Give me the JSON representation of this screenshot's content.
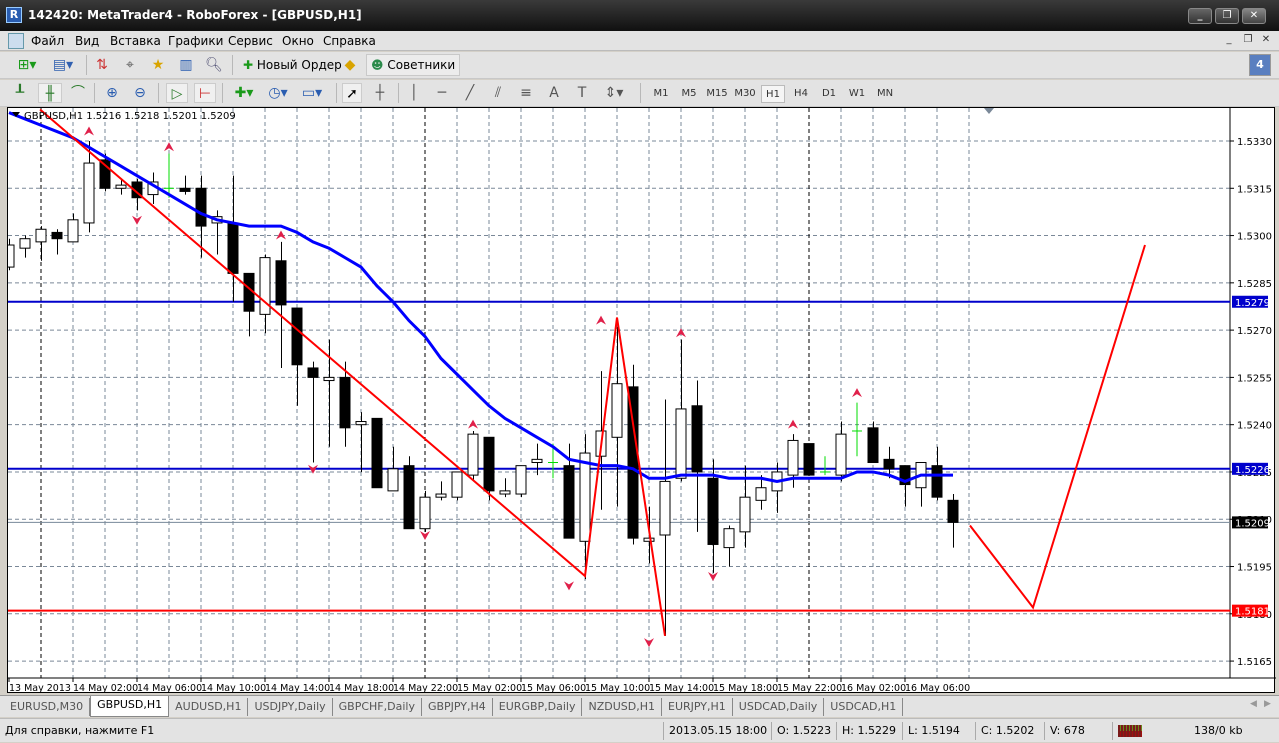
{
  "window": {
    "title": "142420: MetaTrader4 - RoboForex - [GBPUSD,H1]",
    "minimize": "_",
    "restore": "❐",
    "close": "✕"
  },
  "menu": [
    "Файл",
    "Вид",
    "Вставка",
    "Графики",
    "Сервис",
    "Окно",
    "Справка"
  ],
  "toolbar": {
    "new_order": "Новый Ордер",
    "experts": "Советники",
    "notifications_count": "4"
  },
  "timeframes": [
    "M1",
    "M5",
    "M15",
    "M30",
    "H1",
    "H4",
    "D1",
    "W1",
    "MN"
  ],
  "active_timeframe": "H1",
  "chart_header": "GBPUSD,H1  1.5216 1.5218 1.5201 1.5209",
  "tabs": [
    "EURUSD,M30",
    "GBPUSD,H1",
    "AUDUSD,H1",
    "USDJPY,Daily",
    "GBPCHF,Daily",
    "GBPJPY,H4",
    "EURGBP,Daily",
    "NZDUSD,H1",
    "EURJPY,H1",
    "USDCAD,Daily",
    "USDCAD,H1"
  ],
  "active_tab": "GBPUSD,H1",
  "status": {
    "help": "Для справки, нажмите F1",
    "datetime": "2013.05.15 18:00",
    "open": "O: 1.5223",
    "high": "H: 1.5229",
    "low": "L: 1.5194",
    "close": "C: 1.5202",
    "volume": "V: 678",
    "traffic": "138/0 kb"
  },
  "chart_data": {
    "type": "candlestick",
    "symbol": "GBPUSD",
    "timeframe": "H1",
    "ylim": [
      1.5158,
      1.5348
    ],
    "y_ticks": [
      "1.5330",
      "1.5315",
      "1.5300",
      "1.5285",
      "1.5270",
      "1.5255",
      "1.5240",
      "1.5225",
      "1.5210",
      "1.5195",
      "1.5180",
      "1.5165"
    ],
    "x_labels": [
      "13 May 2013",
      "14 May 02:00",
      "14 May 06:00",
      "14 May 10:00",
      "14 May 14:00",
      "14 May 18:00",
      "14 May 22:00",
      "15 May 02:00",
      "15 May 06:00",
      "15 May 10:00",
      "15 May 14:00",
      "15 May 18:00",
      "15 May 22:00",
      "16 May 02:00",
      "16 May 06:00"
    ],
    "day_separators": [
      2,
      26,
      50
    ],
    "ohlc": [
      [
        1.529,
        1.5299,
        1.5289,
        1.5297
      ],
      [
        1.5296,
        1.53,
        1.5293,
        1.5299
      ],
      [
        1.5298,
        1.5303,
        1.5292,
        1.5302
      ],
      [
        1.5301,
        1.5302,
        1.5294,
        1.5299
      ],
      [
        1.5298,
        1.5307,
        1.5298,
        1.5305
      ],
      [
        1.5304,
        1.533,
        1.5301,
        1.5323
      ],
      [
        1.5324,
        1.5326,
        1.5314,
        1.5315
      ],
      [
        1.5315,
        1.5318,
        1.5313,
        1.5316
      ],
      [
        1.5317,
        1.5318,
        1.5308,
        1.5312
      ],
      [
        1.5313,
        1.532,
        1.531,
        1.5317
      ],
      [
        1.5315,
        1.5326,
        1.5312,
        1.5315
      ],
      [
        1.5315,
        1.5319,
        1.5313,
        1.5314
      ],
      [
        1.5315,
        1.5319,
        1.5293,
        1.5303
      ],
      [
        1.5304,
        1.5308,
        1.5294,
        1.5306
      ],
      [
        1.5304,
        1.5319,
        1.5279,
        1.5288
      ],
      [
        1.5288,
        1.5288,
        1.5268,
        1.5276
      ],
      [
        1.5275,
        1.5294,
        1.5269,
        1.5293
      ],
      [
        1.5292,
        1.5298,
        1.5258,
        1.5278
      ],
      [
        1.5277,
        1.5277,
        1.5246,
        1.5259
      ],
      [
        1.5258,
        1.526,
        1.5228,
        1.5255
      ],
      [
        1.5254,
        1.5267,
        1.5233,
        1.5255
      ],
      [
        1.5255,
        1.526,
        1.5233,
        1.5239
      ],
      [
        1.524,
        1.5244,
        1.5225,
        1.5241
      ],
      [
        1.5242,
        1.5242,
        1.522,
        1.522
      ],
      [
        1.5219,
        1.5233,
        1.5219,
        1.5226
      ],
      [
        1.5227,
        1.523,
        1.5207,
        1.5207
      ],
      [
        1.5207,
        1.5219,
        1.5206,
        1.5217
      ],
      [
        1.5217,
        1.5222,
        1.5216,
        1.5218
      ],
      [
        1.5217,
        1.5225,
        1.5216,
        1.5225
      ],
      [
        1.5224,
        1.5238,
        1.5222,
        1.5237
      ],
      [
        1.5236,
        1.5236,
        1.5216,
        1.5219
      ],
      [
        1.5218,
        1.5223,
        1.5217,
        1.5219
      ],
      [
        1.5218,
        1.5227,
        1.5217,
        1.5227
      ],
      [
        1.5228,
        1.5234,
        1.5224,
        1.5229
      ],
      [
        1.5228,
        1.5234,
        1.5223,
        1.5228
      ],
      [
        1.5227,
        1.5234,
        1.5204,
        1.5204
      ],
      [
        1.5203,
        1.5237,
        1.5191,
        1.5231
      ],
      [
        1.523,
        1.5257,
        1.5213,
        1.5238
      ],
      [
        1.5236,
        1.5271,
        1.5214,
        1.5253
      ],
      [
        1.5252,
        1.5259,
        1.5202,
        1.5204
      ],
      [
        1.5203,
        1.5214,
        1.5196,
        1.5204
      ],
      [
        1.5205,
        1.5248,
        1.5173,
        1.5222
      ],
      [
        1.5223,
        1.5267,
        1.5222,
        1.5245
      ],
      [
        1.5246,
        1.5254,
        1.5206,
        1.5225
      ],
      [
        1.5223,
        1.5229,
        1.5193,
        1.5202
      ],
      [
        1.5201,
        1.5208,
        1.5195,
        1.5207
      ],
      [
        1.5206,
        1.5227,
        1.5201,
        1.5217
      ],
      [
        1.5216,
        1.5224,
        1.5213,
        1.522
      ],
      [
        1.5219,
        1.5228,
        1.5212,
        1.5225
      ],
      [
        1.5224,
        1.5237,
        1.522,
        1.5235
      ],
      [
        1.5234,
        1.5234,
        1.5224,
        1.5224
      ],
      [
        1.5225,
        1.523,
        1.5224,
        1.5225
      ],
      [
        1.5224,
        1.5241,
        1.5222,
        1.5237
      ],
      [
        1.5238,
        1.5247,
        1.523,
        1.5238
      ],
      [
        1.5239,
        1.5241,
        1.5228,
        1.5228
      ],
      [
        1.5229,
        1.5233,
        1.5223,
        1.5226
      ],
      [
        1.5227,
        1.5227,
        1.5214,
        1.5221
      ],
      [
        1.522,
        1.5228,
        1.5214,
        1.5228
      ],
      [
        1.5227,
        1.5233,
        1.5216,
        1.5217
      ],
      [
        1.5216,
        1.5218,
        1.5201,
        1.5209
      ]
    ],
    "moving_average": [
      1.5339,
      1.5337,
      1.5335,
      1.5333,
      1.5331,
      1.5328,
      1.5325,
      1.5322,
      1.5319,
      1.5316,
      1.5313,
      1.531,
      1.5307,
      1.5305,
      1.5304,
      1.5303,
      1.5303,
      1.5303,
      1.5301,
      1.5298,
      1.5296,
      1.5293,
      1.529,
      1.5284,
      1.5279,
      1.5273,
      1.5268,
      1.5261,
      1.5256,
      1.5251,
      1.5246,
      1.5242,
      1.5239,
      1.5236,
      1.5233,
      1.5229,
      1.5228,
      1.5227,
      1.5227,
      1.5226,
      1.5223,
      1.5223,
      1.5224,
      1.5224,
      1.5224,
      1.5223,
      1.5223,
      1.5223,
      1.5222,
      1.5223,
      1.5223,
      1.5223,
      1.5223,
      1.5225,
      1.5225,
      1.5224,
      1.5222,
      1.5224,
      1.5224,
      1.5224
    ],
    "ma_color": "#0000ff",
    "zigzag": [
      [
        1.94,
        1.534
      ],
      [
        36,
        1.5192
      ],
      [
        38,
        1.5274
      ],
      [
        41,
        1.5173
      ]
    ],
    "projection": [
      [
        60.06,
        1.5208
      ],
      [
        64,
        1.5182
      ],
      [
        71,
        1.5297
      ]
    ],
    "zigzag_color": "#ff0000",
    "fractals_up": [
      [
        5,
        1.5333
      ],
      [
        10,
        1.5328
      ],
      [
        17,
        1.53
      ],
      [
        29,
        1.524
      ],
      [
        37,
        1.5273
      ],
      [
        42,
        1.5269
      ],
      [
        49,
        1.524
      ],
      [
        53,
        1.525
      ]
    ],
    "fractals_down": [
      [
        8,
        1.5305
      ],
      [
        19,
        1.5226
      ],
      [
        26,
        1.5205
      ],
      [
        35,
        1.5189
      ],
      [
        40,
        1.5171
      ],
      [
        44,
        1.5192
      ]
    ],
    "levels": [
      {
        "price": "1.5279",
        "color": "#0000cc",
        "tag_text": "#ffffff"
      },
      {
        "price": "1.5226",
        "color": "#0000cc",
        "tag_text": "#ffffff"
      },
      {
        "price": "1.5209",
        "color": "#778899",
        "tag_bg": "#000000",
        "tag_text": "#ffffff"
      },
      {
        "price": "1.5181",
        "color": "#ff0000",
        "tag_text": "#ffffff"
      }
    ]
  }
}
